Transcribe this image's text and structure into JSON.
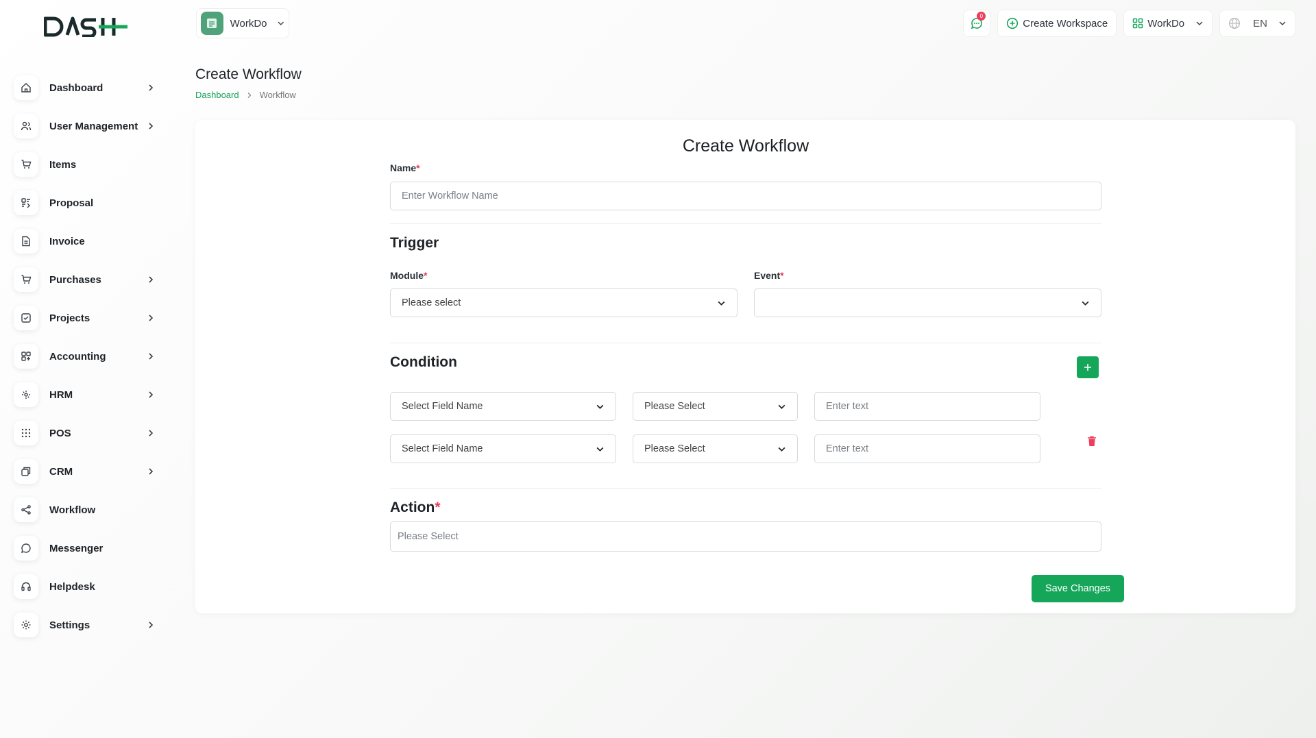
{
  "brand": {
    "logo_text": "DASH",
    "accent": "#15a65a"
  },
  "workspace_switcher": {
    "name": "WorkDo"
  },
  "header": {
    "messages_count": "0",
    "create_workspace_label": "Create Workspace",
    "workspace_label": "WorkDo",
    "language_label": "EN"
  },
  "sidebar": {
    "items": [
      {
        "label": "Dashboard",
        "icon": "home-icon",
        "has_chevron": true
      },
      {
        "label": "User Management",
        "icon": "users-icon",
        "has_chevron": true
      },
      {
        "label": "Items",
        "icon": "cart-icon",
        "has_chevron": false
      },
      {
        "label": "Proposal",
        "icon": "proposal-icon",
        "has_chevron": false
      },
      {
        "label": "Invoice",
        "icon": "file-icon",
        "has_chevron": false
      },
      {
        "label": "Purchases",
        "icon": "cart-icon",
        "has_chevron": true
      },
      {
        "label": "Projects",
        "icon": "checkbox-icon",
        "has_chevron": true
      },
      {
        "label": "Accounting",
        "icon": "grid-icon",
        "has_chevron": true
      },
      {
        "label": "HRM",
        "icon": "hrm-icon",
        "has_chevron": true
      },
      {
        "label": "POS",
        "icon": "dots-grid-icon",
        "has_chevron": true
      },
      {
        "label": "CRM",
        "icon": "crm-icon",
        "has_chevron": true
      },
      {
        "label": "Workflow",
        "icon": "share-icon",
        "has_chevron": false
      },
      {
        "label": "Messenger",
        "icon": "chat-icon",
        "has_chevron": false
      },
      {
        "label": "Helpdesk",
        "icon": "headset-icon",
        "has_chevron": false
      },
      {
        "label": "Settings",
        "icon": "gear-icon",
        "has_chevron": true
      }
    ]
  },
  "page": {
    "title": "Create Workflow",
    "breadcrumb": {
      "root": "Dashboard",
      "current": "Workflow"
    }
  },
  "form": {
    "title": "Create Workflow",
    "name": {
      "label": "Name",
      "required_mark": "*",
      "placeholder": "Enter Workflow Name",
      "value": ""
    },
    "trigger": {
      "heading": "Trigger",
      "module": {
        "label": "Module",
        "required_mark": "*",
        "value": "Please select"
      },
      "event": {
        "label": "Event",
        "required_mark": "*",
        "value": ""
      }
    },
    "condition": {
      "heading": "Condition",
      "rows": [
        {
          "field": "Select Field Name",
          "operator": "Please Select",
          "value_placeholder": "Enter text"
        },
        {
          "field": "Select Field Name",
          "operator": "Please Select",
          "value_placeholder": "Enter text"
        }
      ]
    },
    "action": {
      "heading": "Action",
      "required_mark": "*",
      "placeholder": "Please Select"
    },
    "save_label": "Save Changes"
  }
}
